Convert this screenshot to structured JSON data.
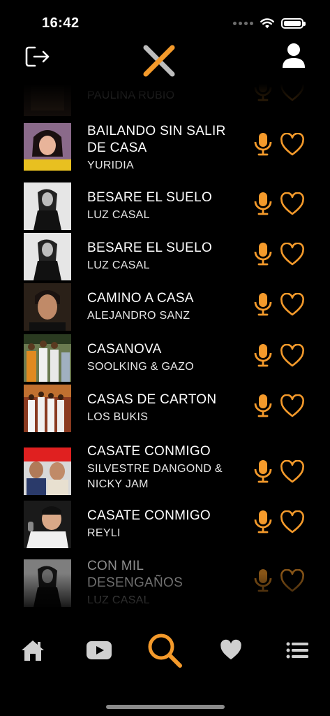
{
  "status_bar": {
    "time": "16:42",
    "battery_level": 1.0
  },
  "header": {
    "logout_icon": "logout-icon",
    "logo_icon": "x-logo-icon",
    "profile_icon": "user-icon"
  },
  "colors": {
    "accent": "#F49A2B",
    "background": "#000000",
    "text": "#FFFFFF",
    "tab_inactive": "#D0D0D0"
  },
  "songs": [
    {
      "title": "",
      "artist": "PAULINA RUBIO"
    },
    {
      "title": "BAILANDO SIN SALIR DE CASA",
      "artist": "YURIDIA"
    },
    {
      "title": "BESARE EL SUELO",
      "artist": "LUZ CASAL"
    },
    {
      "title": "BESARE EL SUELO",
      "artist": "LUZ CASAL"
    },
    {
      "title": "CAMINO A CASA",
      "artist": "ALEJANDRO SANZ"
    },
    {
      "title": "CASANOVA",
      "artist": "SOOLKING & GAZO"
    },
    {
      "title": "CASAS DE CARTON",
      "artist": "LOS BUKIS"
    },
    {
      "title": "CASATE CONMIGO",
      "artist": "SILVESTRE DANGOND & NICKY JAM"
    },
    {
      "title": "CASATE CONMIGO",
      "artist": "REYLI"
    },
    {
      "title": "CON MIL DESENGAÑOS",
      "artist": "LUZ CASAL"
    }
  ],
  "tab_bar": {
    "tabs": [
      {
        "name": "home",
        "icon": "home-icon"
      },
      {
        "name": "videos",
        "icon": "youtube-icon"
      },
      {
        "name": "search",
        "icon": "search-icon",
        "active": true
      },
      {
        "name": "favorites",
        "icon": "heart-icon"
      },
      {
        "name": "lists",
        "icon": "list-icon"
      }
    ]
  }
}
